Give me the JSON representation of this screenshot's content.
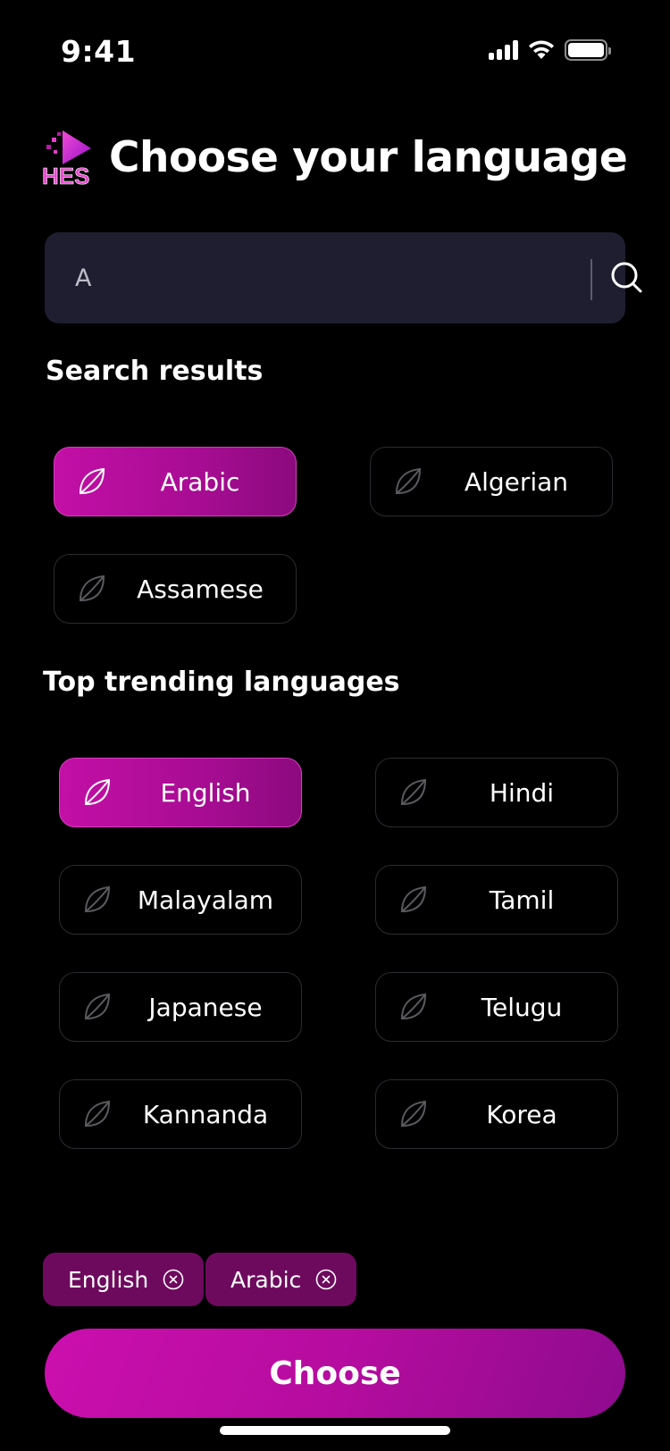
{
  "status_bar": {
    "time": "9:41"
  },
  "header": {
    "logo_text": "HES",
    "title": "Choose your language"
  },
  "search": {
    "value": "A",
    "placeholder": ""
  },
  "search_results": {
    "title": "Search results",
    "items": [
      {
        "label": "Arabic",
        "selected": true
      },
      {
        "label": "Algerian",
        "selected": false
      },
      {
        "label": "Assamese",
        "selected": false
      }
    ]
  },
  "trending": {
    "title": "Top trending  languages",
    "items": [
      {
        "label": "English",
        "selected": true
      },
      {
        "label": "Hindi",
        "selected": false
      },
      {
        "label": "Malayalam",
        "selected": false
      },
      {
        "label": "Tamil",
        "selected": false
      },
      {
        "label": "Japanese",
        "selected": false
      },
      {
        "label": "Telugu",
        "selected": false
      },
      {
        "label": "Kannanda",
        "selected": false
      },
      {
        "label": "Korea",
        "selected": false
      }
    ]
  },
  "selected_tags": [
    {
      "label": "English"
    },
    {
      "label": "Arabic"
    }
  ],
  "choose_button": {
    "label": "Choose"
  },
  "colors": {
    "background": "#000000",
    "accent": "#c30fa6",
    "accent_dark": "#8c0a7e",
    "search_bg": "#1e1e30",
    "tag_bg": "#6e0a5e",
    "chip_border": "#2c2c30"
  },
  "icons": {
    "chip": "leaf-icon",
    "search": "search-icon",
    "tag_remove": "close-circle-icon"
  }
}
